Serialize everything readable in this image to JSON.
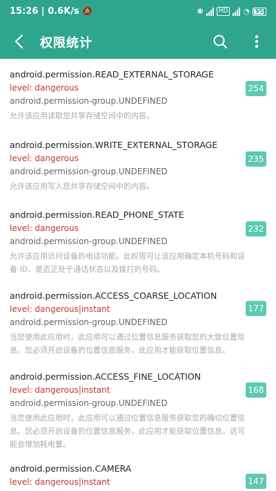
{
  "status_bar": {
    "time": "15:26",
    "speed": "0.6K/s",
    "tag1": "HD",
    "tag2": "HD",
    "battery": "95"
  },
  "toolbar": {
    "title": "权限统计",
    "back_icon": "back-arrow-icon",
    "search_icon": "search-icon",
    "more_icon": "more-vert-icon",
    "color": "#2fa58f"
  },
  "permissions": [
    {
      "name": "android.permission.READ_EXTERNAL_STORAGE",
      "level": "level: dangerous",
      "group": "android.permission-group.UNDEFINED",
      "desc": "允许该应用读取您共享存储空间中的内容。",
      "count": "254"
    },
    {
      "name": "android.permission.WRITE_EXTERNAL_STORAGE",
      "level": "level: dangerous",
      "group": "android.permission-group.UNDEFINED",
      "desc": "允许该应用写入您共享存储空间中的内容。",
      "count": "235"
    },
    {
      "name": "android.permission.READ_PHONE_STATE",
      "level": "level: dangerous",
      "group": "android.permission-group.UNDEFINED",
      "desc": "允许该应用访问设备的电话功能。此权限可让该应用确定本机号码和设备 ID、是否正处于通话状态以及拨打的号码。",
      "count": "232"
    },
    {
      "name": "android.permission.ACCESS_COARSE_LOCATION",
      "level": "level: dangerous|instant",
      "group": "android.permission-group.UNDEFINED",
      "desc": "当您使用此应用时，此应用可以通过位置信息服务获取您的大致位置信息。您必须开启设备的位置信息服务，此应用才能获取位置信息。",
      "count": "177"
    },
    {
      "name": "android.permission.ACCESS_FINE_LOCATION",
      "level": "level: dangerous|instant",
      "group": "android.permission-group.UNDEFINED",
      "desc": "当您使用此应用时，此应用可以通过位置信息服务获取您的确切位置信息。您必须开启设备的位置信息服务，此应用才能获取位置信息。这可能会增加耗电量。",
      "count": "168"
    },
    {
      "name": "android.permission.CAMERA",
      "level": "level: dangerous|instant",
      "group": "",
      "desc": "",
      "count": "147"
    }
  ]
}
